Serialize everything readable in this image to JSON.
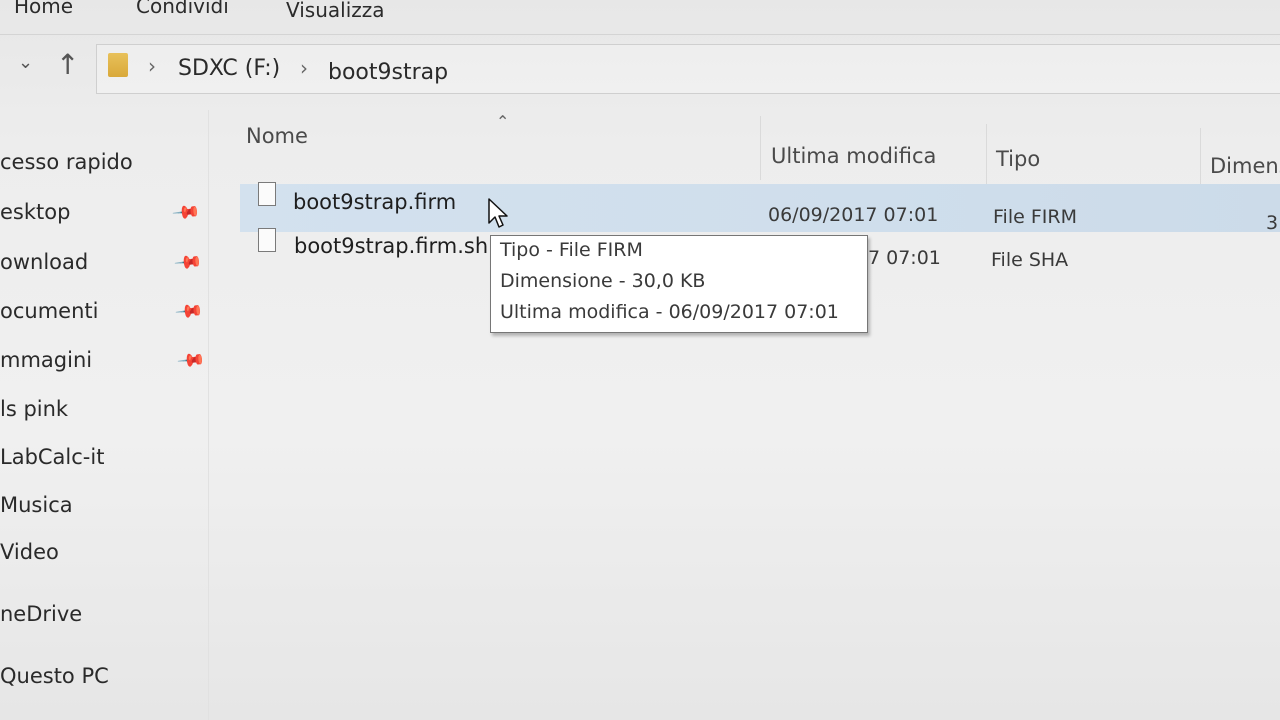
{
  "ribbon": {
    "tabs": [
      "Home",
      "Condividi",
      "Visualizza"
    ]
  },
  "address_bar": {
    "breadcrumbs": [
      "SDXC (F:)",
      "boot9strap"
    ]
  },
  "sidebar": {
    "items": [
      {
        "label": "cesso rapido",
        "pinned": false
      },
      {
        "label": "esktop",
        "pinned": true
      },
      {
        "label": "ownload",
        "pinned": true
      },
      {
        "label": "ocumenti",
        "pinned": true
      },
      {
        "label": "mmagini",
        "pinned": true
      },
      {
        "label": "ls pink",
        "pinned": false
      },
      {
        "label": "LabCalc-it",
        "pinned": false
      },
      {
        "label": "Musica",
        "pinned": false
      },
      {
        "label": "Video",
        "pinned": false
      },
      {
        "label": "neDrive",
        "pinned": false
      },
      {
        "label": "Questo PC",
        "pinned": false
      }
    ]
  },
  "columns": {
    "name": "Nome",
    "modified": "Ultima modifica",
    "type": "Tipo",
    "size": "Dimens"
  },
  "files": [
    {
      "name": "boot9strap.firm",
      "modified": "06/09/2017 07:01",
      "type": "File FIRM",
      "size": "3",
      "selected": true
    },
    {
      "name": "boot9strap.firm.sh",
      "modified": "7 07:01",
      "type": "File SHA",
      "size": "",
      "selected": false
    }
  ],
  "tooltip": {
    "lines": [
      "Tipo - File FIRM",
      "Dimensione - 30,0 KB",
      "Ultima modifica - 06/09/2017 07:01"
    ]
  },
  "colors": {
    "selection": "#cfdeec",
    "folder": "#dcae40"
  }
}
